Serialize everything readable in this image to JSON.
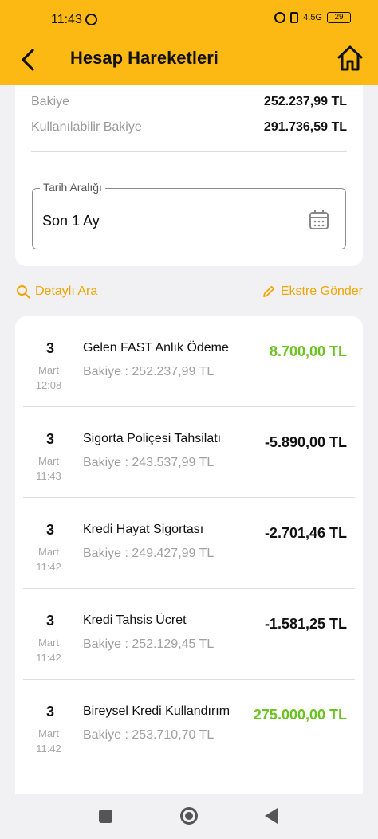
{
  "status_bar": {
    "time": "11:43",
    "network": "4.5G",
    "battery": "29"
  },
  "header": {
    "title": "Hesap Hareketleri",
    "back_icon": "chevron-left-icon",
    "home_icon": "home-icon"
  },
  "balance": {
    "balance_label": "Bakiye",
    "balance_value": "252.237,99 TL",
    "available_label": "Kullanılabilir Bakiye",
    "available_value": "291.736,59 TL"
  },
  "date_range": {
    "label": "Tarih Aralığı",
    "value": "Son 1 Ay",
    "icon": "calendar-icon"
  },
  "actions": {
    "search_label": "Detaylı Ara",
    "statement_label": "Ekstre Gönder"
  },
  "transactions": [
    {
      "day": "3",
      "month": "Mart",
      "time": "12:08",
      "description": "Gelen FAST Anlık Ödeme",
      "balance": "Bakiye : 252.237,99 TL",
      "amount": "8.700,00 TL",
      "type": "positive"
    },
    {
      "day": "3",
      "month": "Mart",
      "time": "11:43",
      "description": "Sigorta Poliçesi Tahsilatı",
      "balance": "Bakiye : 243.537,99 TL",
      "amount": "-5.890,00 TL",
      "type": "negative"
    },
    {
      "day": "3",
      "month": "Mart",
      "time": "11:42",
      "description": "Kredi Hayat Sigortası",
      "balance": "Bakiye : 249.427,99 TL",
      "amount": "-2.701,46 TL",
      "type": "negative"
    },
    {
      "day": "3",
      "month": "Mart",
      "time": "11:42",
      "description": "Kredi Tahsis Ücret",
      "balance": "Bakiye : 252.129,45 TL",
      "amount": "-1.581,25 TL",
      "type": "negative"
    },
    {
      "day": "3",
      "month": "Mart",
      "time": "11:42",
      "description": "Bireysel Kredi Kullandırım",
      "balance": "Bakiye : 253.710,70 TL",
      "amount": "275.000,00 TL",
      "type": "positive"
    }
  ],
  "colors": {
    "brand": "#fdb913",
    "positive": "#6cc223",
    "accent": "#f0a500"
  }
}
